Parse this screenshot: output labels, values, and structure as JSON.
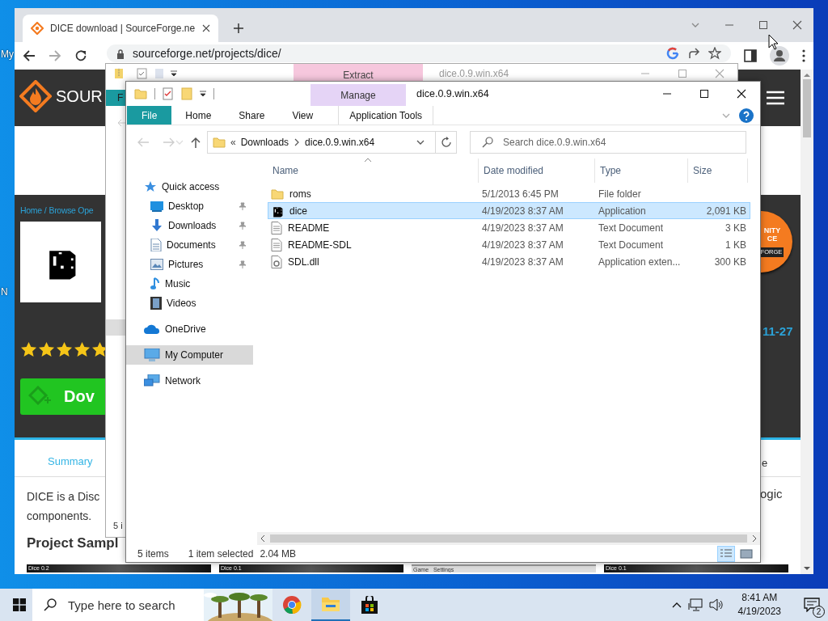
{
  "desktop": {
    "icon_labels": [
      "My",
      "N"
    ]
  },
  "browser": {
    "tabs": [
      {
        "title": "DICE download | SourceForge.ne",
        "selected": true
      }
    ],
    "address": "sourceforge.net/projects/dice/",
    "page": {
      "logo_text": "SOUR",
      "breadcrumb": {
        "items": [
          "Home",
          "Browse Ope"
        ],
        "separator": "/"
      },
      "stars": 5,
      "download_button": "Dov",
      "badge": [
        "NITY",
        "CE",
        "FORGE"
      ],
      "date_fragment": "11-27",
      "nav_tabs": [
        {
          "label": "Summary",
          "selected": true
        },
        {
          "label": "e",
          "selected": false
        }
      ],
      "description": [
        "DICE is a Disc",
        "components."
      ],
      "description_right": "ogic",
      "heading": "Project Sampl",
      "screenshots": [
        {
          "title": "Dice 0.2",
          "kind": "dark"
        },
        {
          "title": "Dice 0.1",
          "kind": "dark"
        },
        {
          "title": "Game   Settings",
          "kind": "light"
        },
        {
          "title": "Dice 0.1",
          "kind": "dark"
        }
      ]
    }
  },
  "explorer_back": {
    "title": "dice.0.9.win.x64",
    "context_tab": "Extract",
    "ribbon_tab_fragment": "F",
    "status_fragment": "5 i"
  },
  "explorer": {
    "title": "dice.0.9.win.x64",
    "context_tab": "Manage",
    "ribbon_tabs": [
      {
        "label": "File",
        "kind": "file",
        "selected": false
      },
      {
        "label": "Home",
        "kind": "plain",
        "selected": false
      },
      {
        "label": "Share",
        "kind": "plain",
        "selected": false
      },
      {
        "label": "View",
        "kind": "plain",
        "selected": false
      },
      {
        "label": "Application Tools",
        "kind": "context",
        "selected": false
      }
    ],
    "path": {
      "overflow": "«",
      "items": [
        "Downloads",
        "dice.0.9.win.x64"
      ]
    },
    "search": {
      "placeholder": "Search dice.0.9.win.x64"
    },
    "nav": [
      {
        "label": "Quick access",
        "kind": "star",
        "selected": false,
        "children": [
          {
            "label": "Desktop",
            "kind": "desktop",
            "pinned": true,
            "selected": false
          },
          {
            "label": "Downloads",
            "kind": "download",
            "pinned": true,
            "selected": false
          },
          {
            "label": "Documents",
            "kind": "document",
            "pinned": true,
            "selected": false
          },
          {
            "label": "Pictures",
            "kind": "picture",
            "pinned": true,
            "selected": false
          },
          {
            "label": "Music",
            "kind": "music",
            "pinned": false,
            "selected": false
          },
          {
            "label": "Videos",
            "kind": "video",
            "pinned": false,
            "selected": false
          }
        ]
      },
      {
        "label": "OneDrive",
        "kind": "cloud",
        "selected": false
      },
      {
        "label": "My Computer",
        "kind": "computer",
        "selected": true
      },
      {
        "label": "Network",
        "kind": "network",
        "selected": false
      }
    ],
    "columns": [
      {
        "label": "Name",
        "sorted": true
      },
      {
        "label": "Date modified",
        "sorted": false
      },
      {
        "label": "Type",
        "sorted": false
      },
      {
        "label": "Size",
        "sorted": false
      }
    ],
    "rows": [
      {
        "name": "roms",
        "date": "5/1/2013 6:45 PM",
        "type": "File folder",
        "size": "",
        "kind": "folder",
        "selected": false
      },
      {
        "name": "dice",
        "date": "4/19/2023 8:37 AM",
        "type": "Application",
        "size": "2,091 KB",
        "kind": "app",
        "selected": true
      },
      {
        "name": "README",
        "date": "4/19/2023 8:37 AM",
        "type": "Text Document",
        "size": "3 KB",
        "kind": "text",
        "selected": false
      },
      {
        "name": "README-SDL",
        "date": "4/19/2023 8:37 AM",
        "type": "Text Document",
        "size": "1 KB",
        "kind": "text",
        "selected": false
      },
      {
        "name": "SDL.dll",
        "date": "4/19/2023 8:37 AM",
        "type": "Application exten...",
        "size": "300 KB",
        "kind": "dll",
        "selected": false
      }
    ],
    "status": {
      "items": "5 items",
      "selection": "1 item selected",
      "size": "2.04 MB"
    },
    "view_modes": [
      {
        "kind": "details",
        "selected": true
      },
      {
        "kind": "tiles",
        "selected": false
      }
    ]
  },
  "taskbar": {
    "search_placeholder": "Type here to search",
    "apps": [
      {
        "kind": "chrome",
        "active": false
      },
      {
        "kind": "explorer",
        "active": true
      },
      {
        "kind": "store",
        "active": false
      }
    ],
    "time": "8:41 AM",
    "date": "4/19/2023",
    "notifications": "2"
  }
}
